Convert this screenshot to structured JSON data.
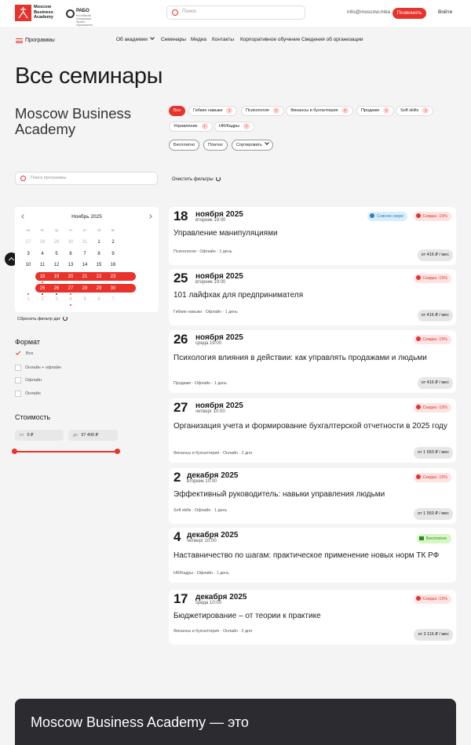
{
  "header": {
    "logo_text": [
      "Moscow",
      "Business",
      "Academy"
    ],
    "rabo_title": "РАБО",
    "rabo_sub": "Российская ассоциация бизнес-образования",
    "search_placeholder": "Поиск",
    "email": "info@moscow.mba",
    "call_label": "Позвонить",
    "login_label": "Войти"
  },
  "nav": {
    "programs_label": "Программы",
    "items": [
      "Об академии",
      "Семинары",
      "Медиа",
      "Контакты",
      "Корпоративное обучение",
      "Сведения об организации"
    ]
  },
  "page_title": "Все семинары",
  "brand_text": "Moscow Business Academy",
  "filters": {
    "categories": [
      {
        "label": "Все",
        "count": ""
      },
      {
        "label": "Гибкие навыки",
        "count": "1"
      },
      {
        "label": "Психология",
        "count": "1"
      },
      {
        "label": "Финансы и бухгалтерия",
        "count": "2"
      },
      {
        "label": "Продажи",
        "count": "1"
      },
      {
        "label": "Soft skills",
        "count": "1"
      },
      {
        "label": "Управление",
        "count": "1"
      },
      {
        "label": "HR/Кадры",
        "count": "1"
      }
    ],
    "price_buttons": [
      "Бесплатно",
      "Платно"
    ],
    "sort_label": "Сортировать",
    "search_placeholder": "Поиск программы",
    "clear_label": "Очистить фильтры"
  },
  "calendar": {
    "month": "Ноябрь 2025",
    "weekdays": [
      "пн",
      "вт",
      "ср",
      "чт",
      "пт",
      "сб",
      "вс"
    ],
    "rows": [
      [
        "27",
        "28",
        "29",
        "30",
        "31",
        "1",
        "2"
      ],
      [
        "3",
        "4",
        "5",
        "6",
        "7",
        "8",
        "9"
      ],
      [
        "10",
        "11",
        "12",
        "13",
        "14",
        "15",
        "16"
      ],
      [
        "17",
        "18",
        "19",
        "20",
        "21",
        "22",
        "23"
      ],
      [
        "24",
        "25",
        "26",
        "27",
        "28",
        "29",
        "30"
      ],
      [
        "1",
        "2",
        "3",
        "4",
        "5",
        "6",
        "7"
      ]
    ],
    "reset_label": "Сбросить фильтр дат"
  },
  "format": {
    "title": "Формат",
    "options": [
      "Все",
      "Онлайн + офлайн",
      "Офлайн",
      "Онлайн"
    ]
  },
  "cost": {
    "title": "Стоимость",
    "from_prefix": "от",
    "from_value": "0 ₽",
    "to_prefix": "до",
    "to_value": "37 400 ₽"
  },
  "seminars": [
    {
      "day": "18",
      "month": "ноября 2025",
      "weekday": "вторник 19:00",
      "title": "Управление манипуляциями",
      "meta": "Психология · Офлайн · 1 день",
      "price": "от 416 ₽ / мес",
      "badge": "Скидка -15%",
      "soon": "Совсем скоро"
    },
    {
      "day": "25",
      "month": "ноября 2025",
      "weekday": "вторник 19:00",
      "title": "101 лайфхак для предпринимателя",
      "meta": "Гибкие навыки · Офлайн · 1 день",
      "price": "от 416 ₽ / мес",
      "badge": "Скидка -15%"
    },
    {
      "day": "26",
      "month": "ноября 2025",
      "weekday": "среда 19:00",
      "title": "Психология влияния в действии: как управлять продажами и людьми",
      "meta": "Продажи · Офлайн · 1 день",
      "price": "от 416 ₽ / мес",
      "badge": "Скидка -15%"
    },
    {
      "day": "27",
      "month": "ноября 2025",
      "weekday": "четверг 10:00",
      "title": "Организация учета и формирование бухгалтерской отчетности в 2025 году",
      "meta": "Финансы и бухгалтерия · Онлайн · 2 дня",
      "price": "от 1 550 ₽ / мес",
      "badge": "Скидка -15%"
    },
    {
      "day": "2",
      "month": "декабря 2025",
      "weekday": "вторник 10:00",
      "title": "Эффективный руководитель: навыки управления людьми",
      "meta": "Soft skills · Офлайн · 1 день",
      "price": "от 1 550 ₽ / мес",
      "badge": "Скидка -15%"
    },
    {
      "day": "4",
      "month": "декабря 2025",
      "weekday": "четверг 10:00",
      "title": "Наставничество по шагам: практическое применение новых норм ТК РФ",
      "meta": "HR/Кадры · Офлайн · 1 день",
      "price": "",
      "badge": "Бесплатно"
    },
    {
      "day": "17",
      "month": "декабря 2025",
      "weekday": "среда 10:00",
      "title": "Бюджетирование – от теории к практике",
      "meta": "Финансы и бухгалтерия · Онлайн · 2 дня",
      "price": "от 3 116 ₽ / мес",
      "badge": "Скидка -15%"
    }
  ],
  "footer_text": "Moscow Business Academy — это"
}
